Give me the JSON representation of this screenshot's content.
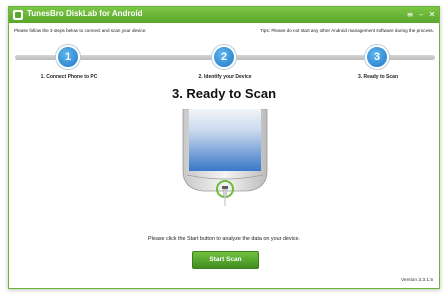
{
  "window": {
    "title": "TunesBro DiskLab for Android",
    "controls": {
      "menu": "≡",
      "minimize": "–",
      "close": "✕"
    },
    "accent_color": "#6bb43a"
  },
  "header": {
    "left_instruction": "Please follow the 3 steps below to connect and scan your device.",
    "right_tip": "Tips: Please do not start any other Android management software during the process."
  },
  "steps": [
    {
      "number": "1",
      "label": "1. Connect Phone to PC"
    },
    {
      "number": "2",
      "label": "2. Identify your Device"
    },
    {
      "number": "3",
      "label": "3. Ready to Scan"
    }
  ],
  "main": {
    "title": "3. Ready to Scan",
    "instruction": "Please click the Start button to analyze the data on your device.",
    "start_button": "Start Scan"
  },
  "footer": {
    "version": "Version 3.3.1.5"
  },
  "icons": {
    "app_logo": "app-logo-icon",
    "phone": "phone-illustration",
    "usb": "usb-cable-icon"
  },
  "colors": {
    "title_bar": "#5aa52c",
    "step_circle": "#2a8ad6",
    "start_button": "#4f9f2a"
  }
}
